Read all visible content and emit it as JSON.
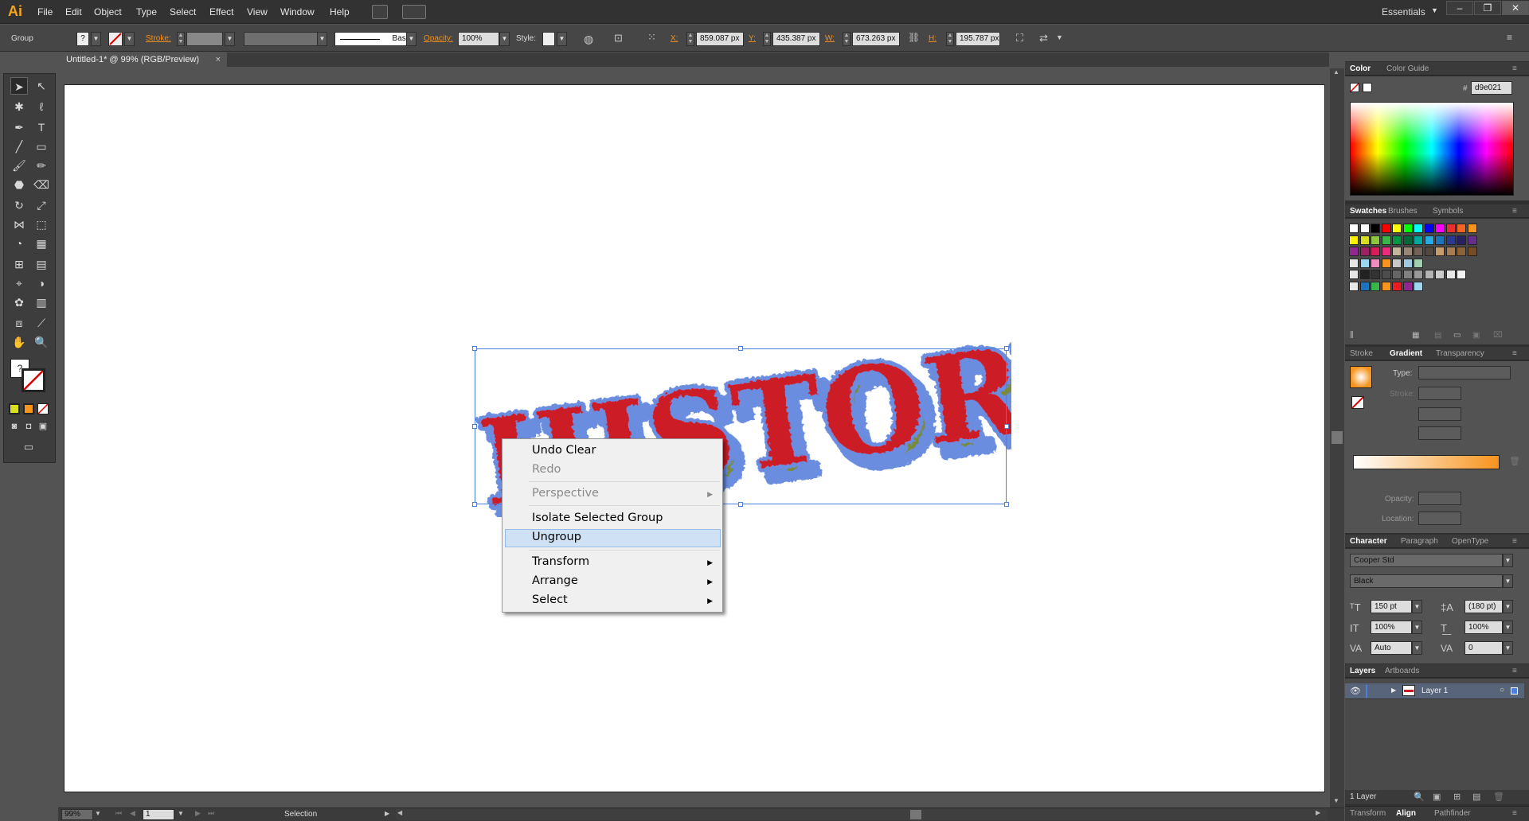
{
  "app": {
    "logo": "Ai",
    "menus": [
      "File",
      "Edit",
      "Object",
      "Type",
      "Select",
      "Effect",
      "View",
      "Window",
      "Help"
    ],
    "workspace": "Essentials",
    "window_buttons": [
      "–",
      "❐",
      "✕"
    ]
  },
  "control_bar": {
    "selection_type": "Group",
    "fill_label": "?",
    "stroke_label": "Stroke:",
    "brush_label": "Basic",
    "opacity_label": "Opacity:",
    "opacity_value": "100%",
    "style_label": "Style:",
    "x_label": "X:",
    "x_value": "859.087 px",
    "y_label": "Y:",
    "y_value": "435.387 px",
    "w_label": "W:",
    "w_value": "673.263 px",
    "h_label": "H:",
    "h_value": "195.787 px"
  },
  "document": {
    "tab_title": "Untitled-1* @ 99% (RGB/Preview)",
    "close": "×",
    "artwork_text": "HISTORY",
    "artwork_fill_color": "#d9e021",
    "artwork_text_color": "#cc1a27",
    "artwork_outline_color": "#6b8de0"
  },
  "context_menu": {
    "items": [
      {
        "label": "Undo Clear",
        "enabled": true,
        "submenu": false
      },
      {
        "label": "Redo",
        "enabled": false,
        "submenu": false
      },
      {
        "label": "Perspective",
        "enabled": false,
        "submenu": true
      },
      {
        "label": "Isolate Selected Group",
        "enabled": true,
        "submenu": false
      },
      {
        "label": "Ungroup",
        "enabled": true,
        "submenu": false,
        "highlighted": true
      },
      {
        "label": "Transform",
        "enabled": true,
        "submenu": true
      },
      {
        "label": "Arrange",
        "enabled": true,
        "submenu": true
      },
      {
        "label": "Select",
        "enabled": true,
        "submenu": true
      }
    ]
  },
  "status_bar": {
    "zoom": "99%",
    "artboard": "1",
    "tool": "Selection"
  },
  "panels": {
    "color": {
      "tabs": [
        "Color",
        "Color Guide"
      ],
      "hex_label": "#",
      "hex_value": "d9e021"
    },
    "swatches": {
      "tabs": [
        "Swatches",
        "Brushes",
        "Symbols"
      ]
    },
    "gradient": {
      "tabs": [
        "Stroke",
        "Gradient",
        "Transparency"
      ],
      "type_label": "Type:",
      "stroke_label": "Stroke:",
      "opacity_label": "Opacity:",
      "location_label": "Location:"
    },
    "character": {
      "tabs": [
        "Character",
        "Paragraph",
        "OpenType"
      ],
      "font": "Cooper Std",
      "style": "Black",
      "size": "150 pt",
      "leading": "(180 pt)",
      "vscale": "100%",
      "hscale": "100%",
      "kerning": "Auto",
      "tracking": "0"
    },
    "layers": {
      "tabs": [
        "Layers",
        "Artboards"
      ],
      "layer_name": "Layer 1",
      "count": "1 Layer"
    },
    "bottom_tabs": [
      "Transform",
      "Align",
      "Pathfinder"
    ]
  }
}
